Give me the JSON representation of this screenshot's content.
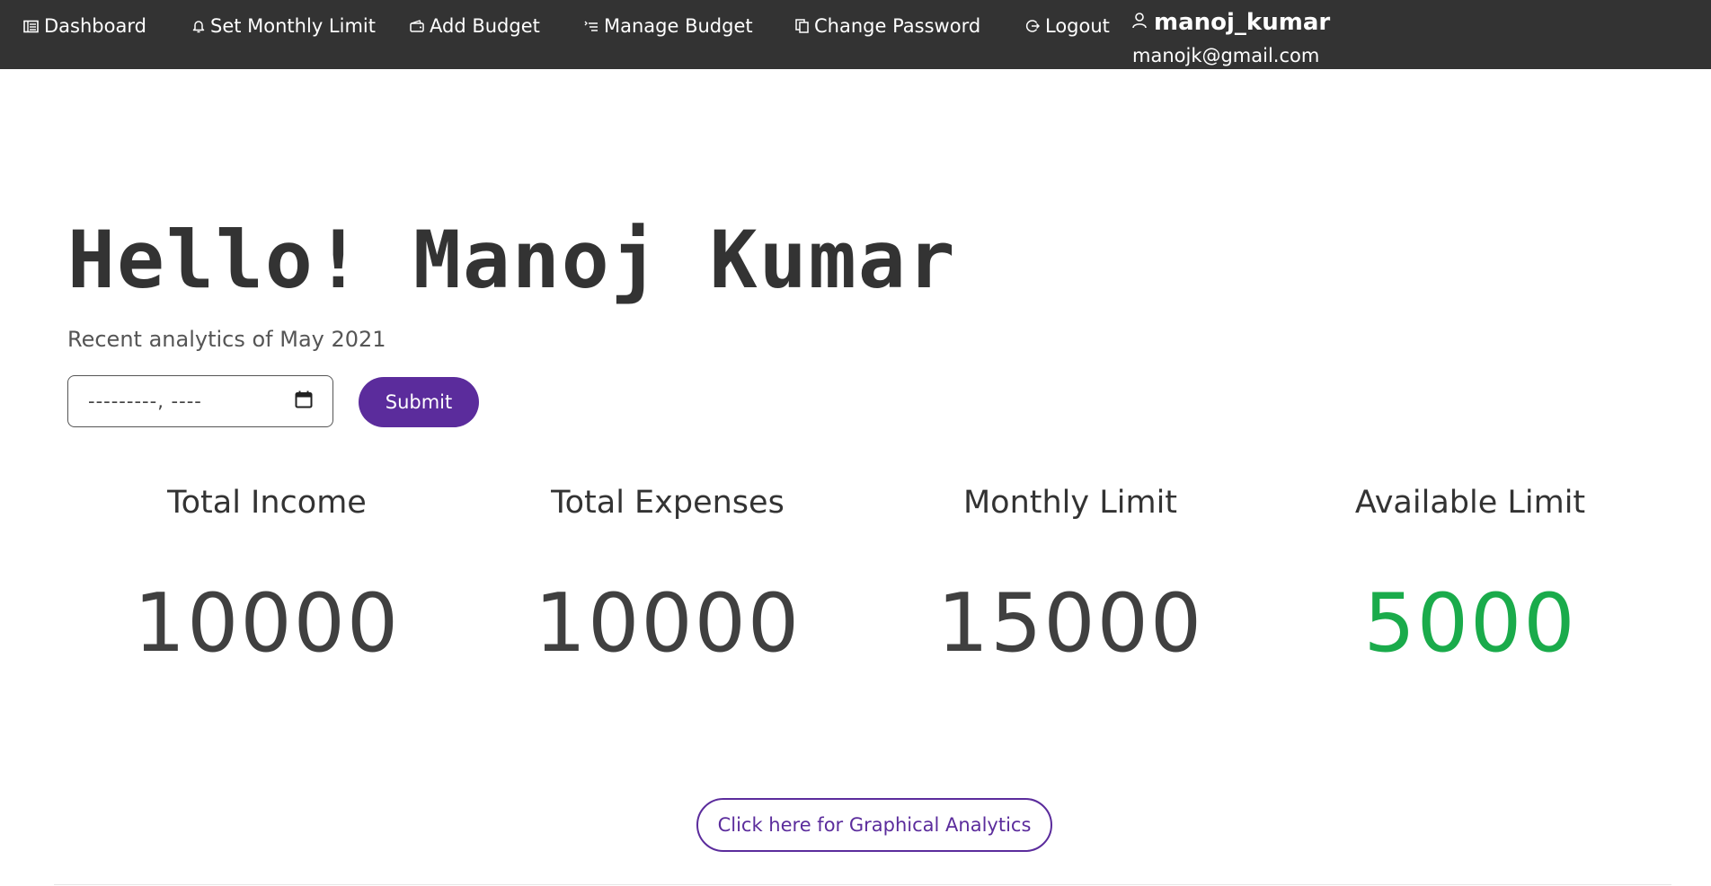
{
  "nav": {
    "items": [
      {
        "label": "Dashboard",
        "icon": "dashboard-icon"
      },
      {
        "label": "Set Monthly Limit",
        "icon": "bell-icon"
      },
      {
        "label": "Add Budget",
        "icon": "wallet-icon"
      },
      {
        "label": "Manage Budget",
        "icon": "list-icon"
      },
      {
        "label": "Change Password",
        "icon": "copy-icon"
      },
      {
        "label": "Logout",
        "icon": "logout-icon"
      }
    ],
    "user": {
      "username": "manoj_kumar",
      "email": "manojk@gmail.com",
      "icon": "user-icon"
    }
  },
  "main": {
    "greeting": "Hello! Manoj Kumar",
    "subtitle": "Recent analytics of May 2021",
    "date_input": {
      "placeholder": "---------, ----",
      "icon": "calendar-icon"
    },
    "submit_label": "Submit",
    "stats": [
      {
        "label": "Total Income",
        "value": "10000"
      },
      {
        "label": "Total Expenses",
        "value": "10000"
      },
      {
        "label": "Monthly Limit",
        "value": "15000"
      },
      {
        "label": "Available Limit",
        "value": "5000"
      }
    ],
    "analytics_button_label": "Click here for Graphical Analytics"
  },
  "colors": {
    "navbar_bg": "#333333",
    "accent_purple": "#5b2c9c",
    "available_green": "#1aab4b",
    "text_dark": "#333333"
  }
}
